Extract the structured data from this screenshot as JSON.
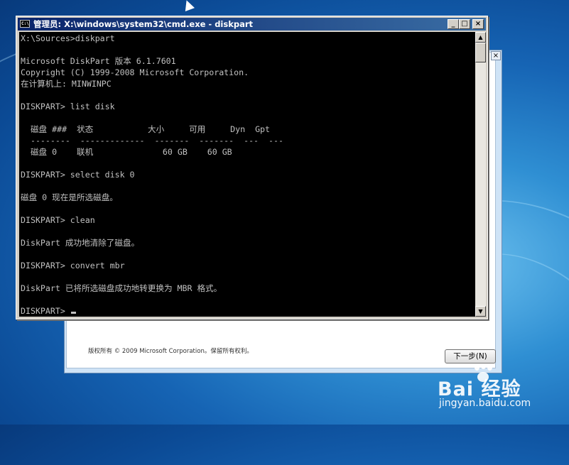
{
  "cmd": {
    "title": "管理员: X:\\windows\\system32\\cmd.exe - diskpart",
    "icon_label": "C:\\",
    "buttons": {
      "minimize": "_",
      "maximize": "□",
      "close": "×"
    },
    "lines": [
      "X:\\Sources>diskpart",
      "",
      "Microsoft DiskPart 版本 6.1.7601",
      "Copyright (C) 1999-2008 Microsoft Corporation.",
      "在计算机上: MINWINPC",
      "",
      "DISKPART> list disk",
      "",
      "  磁盘 ###  状态           大小     可用     Dyn  Gpt",
      "  --------  -------------  -------  -------  ---  ---",
      "  磁盘 0    联机              60 GB    60 GB",
      "",
      "DISKPART> select disk 0",
      "",
      "磁盘 0 现在是所选磁盘。",
      "",
      "DISKPART> clean",
      "",
      "DiskPart 成功地清除了磁盘。",
      "",
      "DISKPART> convert mbr",
      "",
      "DiskPart 已将所选磁盘成功地转更换为 MBR 格式。",
      "",
      "DISKPART> "
    ],
    "scroll_up": "▲",
    "scroll_down": "▼"
  },
  "setup": {
    "close_label": "×",
    "copyright": "版权所有 © 2009 Microsoft Corporation。保留所有权利。",
    "next_button": "下一步(N)"
  },
  "watermark": {
    "logo": "Bai  经验",
    "url": "jingyan.baidu.com"
  }
}
